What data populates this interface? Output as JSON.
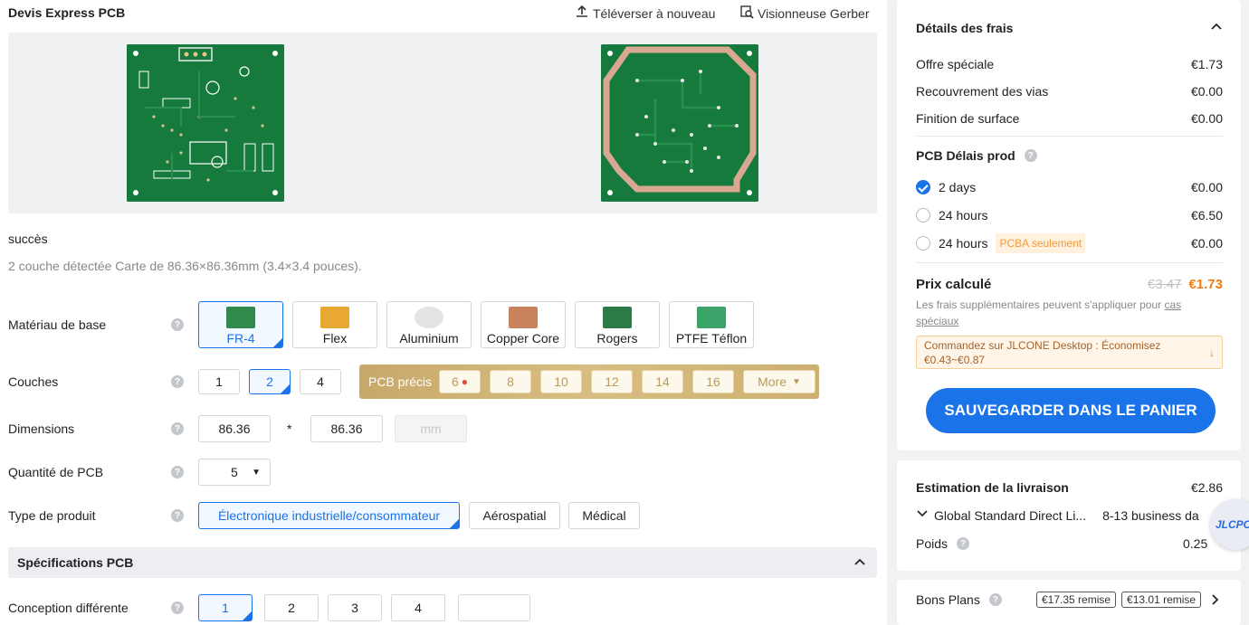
{
  "header": {
    "title": "Devis Express PCB",
    "upload_label": "Téléverser à nouveau",
    "gerber_label": "Visionneuse Gerber"
  },
  "status": {
    "success": "succès",
    "detected": "2 couche détectée Carte de 86.36×86.36mm (3.4×3.4 pouces)."
  },
  "form": {
    "base_material": {
      "label": "Matériau de base",
      "options": [
        "FR-4",
        "Flex",
        "Aluminium",
        "Copper Core",
        "Rogers",
        "PTFE Téflon"
      ],
      "selected": "FR-4"
    },
    "layers": {
      "label": "Couches",
      "options": [
        "1",
        "2",
        "4"
      ],
      "selected": "2",
      "precise_label": "PCB précis",
      "precise_options": [
        "6",
        "8",
        "10",
        "12",
        "14",
        "16"
      ],
      "more_label": "More"
    },
    "dimensions": {
      "label": "Dimensions",
      "width": "86.36",
      "sep": "*",
      "height": "86.36",
      "unit": "mm"
    },
    "quantity": {
      "label": "Quantité de PCB",
      "value": "5"
    },
    "product_type": {
      "label": "Type de produit",
      "options": [
        "Électronique industrielle/consommateur",
        "Aérospatial",
        "Médical"
      ],
      "selected": "Électronique industrielle/consommateur"
    },
    "spec_section": "Spécifications PCB",
    "design": {
      "label": "Conception différente",
      "options": [
        "1",
        "2",
        "3",
        "4"
      ],
      "custom": "",
      "selected": "1"
    }
  },
  "fees": {
    "title": "Détails des frais",
    "items": [
      {
        "label": "Offre spéciale",
        "value": "€1.73"
      },
      {
        "label": "Recouvrement des vias",
        "value": "€0.00"
      },
      {
        "label": "Finition de surface",
        "value": "€0.00"
      }
    ],
    "lead_title": "PCB Délais prod",
    "lead_options": [
      {
        "label": "2 days",
        "value": "€0.00",
        "selected": true
      },
      {
        "label": "24 hours",
        "value": "€6.50",
        "selected": false
      },
      {
        "label": "24 hours",
        "tag": "PCBA seulement",
        "value": "€0.00",
        "selected": false
      }
    ],
    "total_label": "Prix calculé",
    "old_price": "€3.47",
    "new_price": "€1.73",
    "extra_note": "Les frais supplémentaires peuvent s'appliquer pour",
    "extra_link": "cas spéciaux",
    "promo": "Commandez sur JLCONE Desktop : Économisez €0.43~€0.87",
    "save_button": "SAUVEGARDER DANS LE PANIER"
  },
  "shipping": {
    "title": "Estimation de la livraison",
    "cost": "€2.86",
    "method": "Global Standard Direct Li...",
    "days": "8-13 business da",
    "weight_label": "Poids",
    "weight_value": "0.25",
    "badge": "JLCPCB"
  },
  "deals": {
    "label": "Bons Plans",
    "coupons": [
      "€17.35 remise",
      "€13.01 remise"
    ]
  },
  "colors": {
    "accent": "#1a73e8",
    "price": "#f57c0f",
    "gold": "#c7a869",
    "pcb_green": "#157a3c"
  }
}
